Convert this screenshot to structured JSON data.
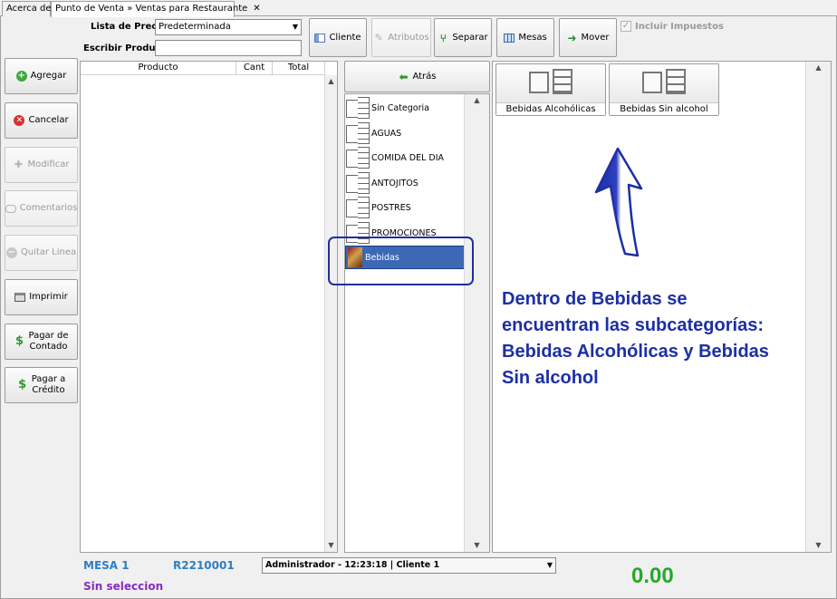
{
  "tabs": [
    {
      "label": "Acerca de"
    },
    {
      "label": "Punto de Venta » Ventas para Restaurante",
      "close": "✕"
    }
  ],
  "form": {
    "price_list_label": "Lista de Precios",
    "price_list_value": "Predeterminada",
    "product_label": "Escribir Producto",
    "product_value": ""
  },
  "toolbar": {
    "cliente": "Cliente",
    "atributos": "Atributos",
    "separar": "Separar",
    "mesas": "Mesas",
    "mover": "Mover",
    "incluir_impuestos": "Incluir Impuestos"
  },
  "sidebar": {
    "agregar": "Agregar",
    "cancelar": "Cancelar",
    "modificar": "Modificar",
    "comentarios": "Comentarios",
    "quitar_linea": "Quitar Linea",
    "imprimir": "Imprimir",
    "pagar_contado_1": "Pagar de",
    "pagar_contado_2": "Contado",
    "pagar_credito_1": "Pagar a",
    "pagar_credito_2": "Crédito"
  },
  "grid": {
    "columns": [
      "Producto",
      "Cant",
      "Total"
    ]
  },
  "categories": {
    "back": "Atrás",
    "items": [
      "Sin Categoria",
      "AGUAS",
      "COMIDA DEL DIA",
      "ANTOJITOS",
      "POSTRES",
      "PROMOCIONES",
      "Bebidas"
    ],
    "selected": "Bebidas"
  },
  "subcategories": [
    "Bebidas Alcohólicas",
    "Bebidas Sin alcohol"
  ],
  "annotation": {
    "lines": [
      "Dentro de Bebidas se",
      "encuentran las subcategorías:",
      "Bebidas Alcohólicas y Bebidas",
      "Sin alcohol"
    ],
    "color": "#1d2fa5"
  },
  "status": {
    "mesa": "MESA 1",
    "ticket": "R2210001",
    "user_select": "Administrador - 12:23:18 | Cliente 1",
    "selection": "Sin seleccion",
    "total": "0.00"
  },
  "colors": {
    "selected_category": "#3c68b4",
    "highlight_border": "#1f2ea0",
    "total_green": "#27a82a",
    "mesa_blue": "#2f7ec2",
    "selection_purple": "#8a2bc2"
  }
}
